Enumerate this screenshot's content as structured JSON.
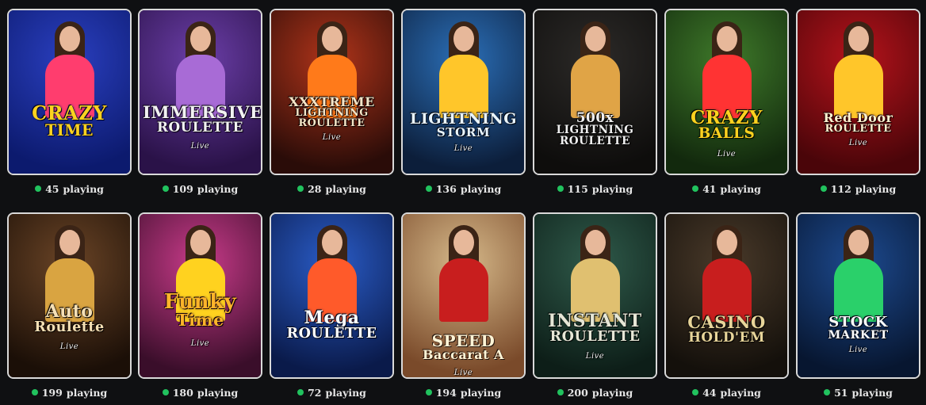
{
  "status_color": "#21c25e",
  "games": [
    {
      "title_lines": [
        "CRAZY",
        "TIME",
        ""
      ],
      "live_label": "",
      "players": "45",
      "playing_label": "playing",
      "colors": {
        "bg1": "#2a3fbf",
        "bg2": "#0c1a6e",
        "accent": "#ff3d6e",
        "text": "#ffd21f"
      }
    },
    {
      "title_lines": [
        "IMMERSIVE",
        "ROULETTE",
        ""
      ],
      "live_label": "Live",
      "players": "109",
      "playing_label": "playing",
      "colors": {
        "bg1": "#6b3ea8",
        "bg2": "#2a1248",
        "accent": "#a86bd6",
        "text": "#f2f2f2"
      }
    },
    {
      "title_lines": [
        "XXXTREME",
        "LIGHTNING",
        "ROULETTE"
      ],
      "live_label": "Live",
      "players": "28",
      "playing_label": "playing",
      "colors": {
        "bg1": "#b0341a",
        "bg2": "#2a0c08",
        "accent": "#ff7a1a",
        "text": "#f5e6c8"
      }
    },
    {
      "title_lines": [
        "LIGHTNING",
        "STORM",
        ""
      ],
      "live_label": "Live",
      "players": "136",
      "playing_label": "playing",
      "colors": {
        "bg1": "#2b6fb8",
        "bg2": "#0c1e3a",
        "accent": "#ffc62a",
        "text": "#eaf6ff"
      }
    },
    {
      "title_lines": [
        "500x",
        "LIGHTNING",
        "ROULETTE"
      ],
      "live_label": "",
      "players": "115",
      "playing_label": "playing",
      "colors": {
        "bg1": "#2c2a28",
        "bg2": "#0e0d0c",
        "accent": "#e0a446",
        "text": "#f0f0f0"
      }
    },
    {
      "title_lines": [
        "CRAZY",
        "BALLS",
        ""
      ],
      "live_label": "Live",
      "players": "41",
      "playing_label": "playing",
      "colors": {
        "bg1": "#3f7a2a",
        "bg2": "#12290d",
        "accent": "#ff3333",
        "text": "#ffd21f"
      }
    },
    {
      "title_lines": [
        "Red Door",
        "ROULETTE",
        ""
      ],
      "live_label": "Live",
      "players": "112",
      "playing_label": "playing",
      "colors": {
        "bg1": "#b5131b",
        "bg2": "#4a0509",
        "accent": "#ffc62a",
        "text": "#fff2d0"
      }
    },
    {
      "title_lines": [
        "Auto",
        "Roulette",
        ""
      ],
      "live_label": "Live",
      "players": "199",
      "playing_label": "playing",
      "colors": {
        "bg1": "#6a4426",
        "bg2": "#1b0f07",
        "accent": "#d9a441",
        "text": "#f5e0b5"
      }
    },
    {
      "title_lines": [
        "Funky",
        "Time",
        ""
      ],
      "live_label": "Live",
      "players": "180",
      "playing_label": "playing",
      "colors": {
        "bg1": "#c93b8a",
        "bg2": "#3a0e2a",
        "accent": "#ffd21f",
        "text": "#ffb42a"
      }
    },
    {
      "title_lines": [
        "Mega",
        "ROULETTE",
        ""
      ],
      "live_label": "",
      "players": "72",
      "playing_label": "playing",
      "colors": {
        "bg1": "#2a5cc7",
        "bg2": "#0a1a4a",
        "accent": "#ff5a2a",
        "text": "#ffffff"
      }
    },
    {
      "title_lines": [
        "SPEED",
        "Baccarat A",
        ""
      ],
      "live_label": "Live",
      "players": "194",
      "playing_label": "playing",
      "colors": {
        "bg1": "#d6b98a",
        "bg2": "#7a4a2a",
        "accent": "#c81e1e",
        "text": "#fff4d6"
      }
    },
    {
      "title_lines": [
        "INSTANT",
        "ROULETTE",
        ""
      ],
      "live_label": "Live",
      "players": "200",
      "playing_label": "playing",
      "colors": {
        "bg1": "#2f5a4a",
        "bg2": "#0d1e18",
        "accent": "#e0c070",
        "text": "#e6e6d6"
      }
    },
    {
      "title_lines": [
        "CASINO",
        "HOLD'EM",
        ""
      ],
      "live_label": "",
      "players": "44",
      "playing_label": "playing",
      "colors": {
        "bg1": "#4a3a2a",
        "bg2": "#14100b",
        "accent": "#c81e1e",
        "text": "#e8d59a"
      }
    },
    {
      "title_lines": [
        "STOCK",
        "MARKET",
        ""
      ],
      "live_label": "Live",
      "players": "51",
      "playing_label": "playing",
      "colors": {
        "bg1": "#1d4a8f",
        "bg2": "#071630",
        "accent": "#2ad06a",
        "text": "#ffffff"
      }
    }
  ]
}
